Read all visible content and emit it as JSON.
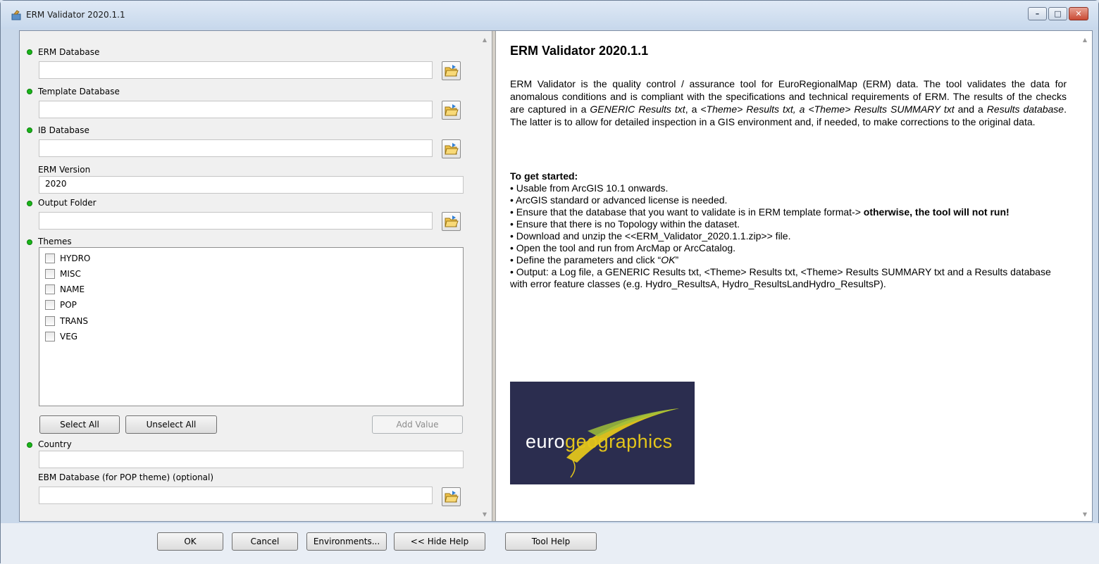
{
  "window": {
    "title": "ERM Validator 2020.1.1",
    "controls": {
      "minimize": "–",
      "maximize": "□",
      "close": "✕"
    }
  },
  "params": {
    "erm_database": {
      "label": "ERM Database",
      "value": ""
    },
    "template_database": {
      "label": "Template Database",
      "value": ""
    },
    "ib_database": {
      "label": "IB Database",
      "value": ""
    },
    "erm_version": {
      "label": "ERM Version",
      "value": "2020"
    },
    "output_folder": {
      "label": "Output Folder",
      "value": ""
    },
    "themes": {
      "label": "Themes",
      "items": [
        {
          "label": "HYDRO",
          "checked": false
        },
        {
          "label": "MISC",
          "checked": false
        },
        {
          "label": "NAME",
          "checked": false
        },
        {
          "label": "POP",
          "checked": false
        },
        {
          "label": "TRANS",
          "checked": false
        },
        {
          "label": "VEG",
          "checked": false
        }
      ],
      "select_all": "Select All",
      "unselect_all": "Unselect All",
      "add_value": "Add Value"
    },
    "country": {
      "label": "Country",
      "value": ""
    },
    "ebm_database": {
      "label": "EBM Database (for POP theme) (optional)",
      "value": ""
    }
  },
  "help": {
    "title": "ERM Validator 2020.1.1",
    "intro_1": "ERM Validator is the quality control / assurance tool for EuroRegionalMap (ERM) data. The tool validates the data for anomalous conditions and is compliant with the specifications and technical requirements of ERM. The results of the checks are captured in a ",
    "intro_em1": "GENERIC Results txt",
    "intro_2": ", a ",
    "intro_em2": "<Theme> Results txt, a <Theme> Results SUMMARY txt",
    "intro_3": " and a ",
    "intro_em3": "Results database",
    "intro_4": ". The latter is to allow for detailed inspection in a GIS environment and, if needed, to make corrections to the original data.",
    "started_title": "To get started:",
    "b1": "• Usable from ArcGIS 10.1 onwards.",
    "b2": "• ArcGIS standard or advanced license is needed.",
    "b3_text": "• Ensure that the database that you want to validate is in ERM template format-> ",
    "b3_bold": "otherwise, the tool will not run!",
    "b4": "• Ensure that there is no Topology within the dataset.",
    "b5": "• Download and unzip the <<ERM_Validator_2020.1.1.zip>> file.",
    "b6": "• Open the tool and run from ArcMap or ArcCatalog.",
    "b7_text": "• Define the parameters and click “",
    "b7_em": "OK",
    "b7_end": "”",
    "b8": "• Output: a Log file, a GENERIC Results txt, <Theme> Results txt, <Theme> Results SUMMARY txt and a Results database with error feature classes (e.g. Hydro_ResultsA, Hydro_ResultsLandHydro_ResultsP).",
    "logo_part1": "euro",
    "logo_part2": "geographics"
  },
  "buttons": {
    "ok": "OK",
    "cancel": "Cancel",
    "environments": "Environments...",
    "hide_help": "<< Hide Help",
    "tool_help": "Tool Help"
  },
  "colors": {
    "required_dot": "#19b619",
    "logo_bg": "#2b2d4f",
    "logo_accent": "#e3c51b"
  }
}
